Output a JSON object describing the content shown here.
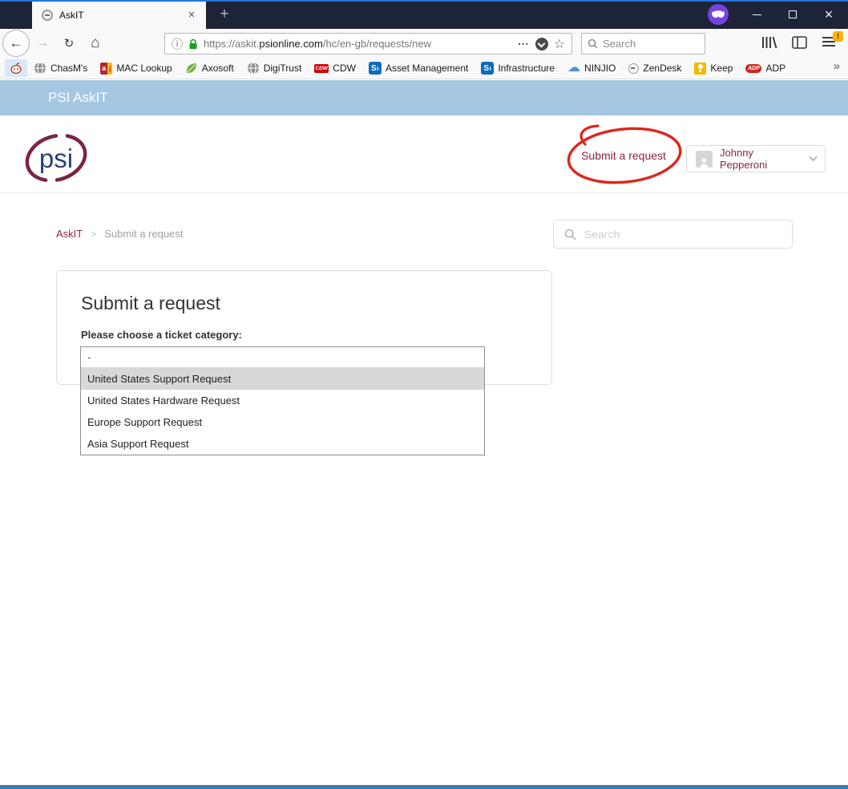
{
  "colors": {
    "brand_maroon": "#8b2346",
    "banner_blue": "#a5c7e1",
    "annotation_red": "#e0251b",
    "active_tab_accent": "#0a84ff",
    "titlebar_navy": "#1d2438",
    "private_badge_purple": "#7643e1",
    "bottom_bar_blue": "#3b7dad",
    "option_highlight": "#d8d8d8"
  },
  "icons": {
    "new_tab": "+",
    "tab_close": "×",
    "window_close": "×",
    "back": "←",
    "forward": "→",
    "refresh": "↻",
    "home": "⌂",
    "info": "ⓘ",
    "page_actions": "⋯",
    "star": "☆",
    "bookmarks_overflow": "»",
    "menu_badge": "!"
  },
  "window": {
    "tab_title": "AskIT"
  },
  "browser": {
    "url_prefix": "https://askit.",
    "url_domain": "psionline.com",
    "url_path": "/hc/en-gb/requests/new",
    "search_placeholder": "Search",
    "bookmarks": [
      {
        "label": "",
        "icon": "reddit-icon"
      },
      {
        "label": "ChasM's",
        "icon": "globe-icon"
      },
      {
        "label": "MAC Lookup",
        "icon": "mac-lookup-icon"
      },
      {
        "label": "Axosoft",
        "icon": "leaf-icon"
      },
      {
        "label": "DigiTrust",
        "icon": "globe-icon"
      },
      {
        "label": "CDW",
        "icon": "cdw-icon"
      },
      {
        "label": "Asset Management",
        "icon": "sharepoint-icon"
      },
      {
        "label": "Infrastructure",
        "icon": "sharepoint-icon"
      },
      {
        "label": "NINJIO",
        "icon": "cloud-icon"
      },
      {
        "label": "ZenDesk",
        "icon": "zendesk-icon"
      },
      {
        "label": "Keep",
        "icon": "keep-icon"
      },
      {
        "label": "ADP",
        "icon": "adp-icon"
      }
    ],
    "sharepoint_glyph": "S›",
    "cdw_glyph": "CDW",
    "adp_glyph": "ADP",
    "mac_a": "a",
    "mac_j": "j",
    "cloud_glyph": "☁"
  },
  "site": {
    "banner_title": "PSI AskIT",
    "logo_text": "psi",
    "submit_request_link": "Submit a request",
    "user_name": "Johnny Pepperoni",
    "breadcrumb_root": "AskIT",
    "breadcrumb_separator": ">",
    "breadcrumb_current": "Submit a request",
    "search_placeholder": "Search",
    "form_title": "Submit a request",
    "category_label": "Please choose a ticket category:",
    "select_value": "-",
    "select_options": [
      "United States Support Request",
      "United States Hardware Request",
      "Europe Support Request",
      "Asia Support Request"
    ],
    "highlighted_option": "United States Support Request"
  }
}
